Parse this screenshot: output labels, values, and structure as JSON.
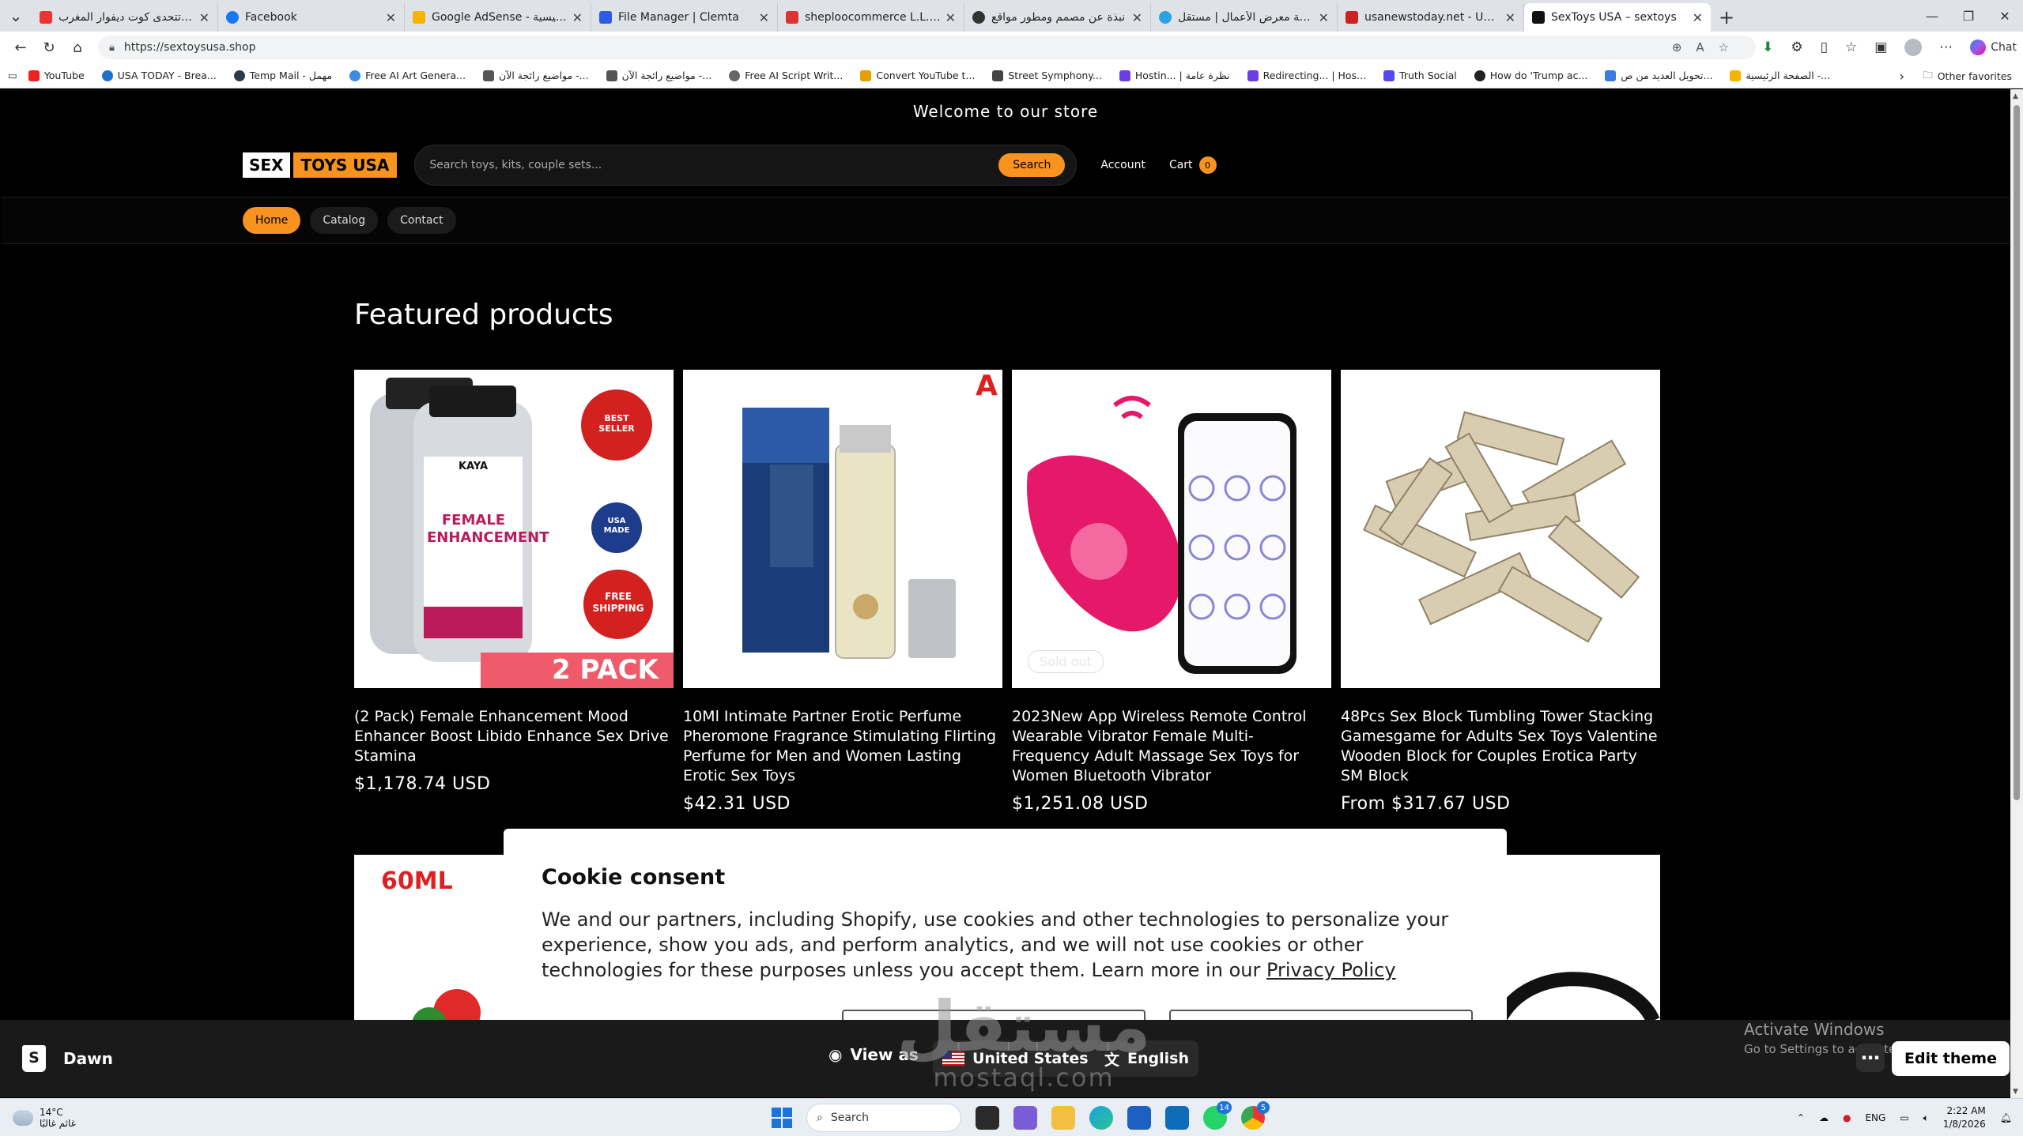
{
  "browser": {
    "tabs": [
      {
        "title": "مصر تتحدى كوت ديفوار المغرب...",
        "color": "#e33"
      },
      {
        "title": "Facebook",
        "color": "#1877f2"
      },
      {
        "title": "Google AdSense - الصفحة الرئيسية",
        "color": "#f4b400"
      },
      {
        "title": "File Manager | Clemta",
        "color": "#2d5be3"
      },
      {
        "title": "sheploocommerce L.L.C.- EIN Letter...",
        "color": "#d33"
      },
      {
        "title": "نبذة عن مصمم ومطور مواقع",
        "color": "#333"
      },
      {
        "title": "إضافة معرض الأعمال | مستقل",
        "color": "#2aa3e3"
      },
      {
        "title": "usanewstoday.net - USANewsToday...",
        "color": "#c22"
      },
      {
        "title": "SexToys USA – sextoys",
        "color": "#111"
      }
    ],
    "url": "https://sextoysusa.shop",
    "chat_label": "Chat",
    "bookmarks": [
      {
        "label": "YouTube",
        "color": "#e22"
      },
      {
        "label": "USA TODAY - Brea...",
        "color": "#1a73c8"
      },
      {
        "label": "Temp Mail - مهمل",
        "color": "#2b3b4b"
      },
      {
        "label": "Free AI Art Genera...",
        "color": "#3a8de0"
      },
      {
        "label": "مواضيع رائجة الآن -...",
        "color": "#555"
      },
      {
        "label": "مواضيع رائجة الآن -...",
        "color": "#555"
      },
      {
        "label": "Free AI Script Writ...",
        "color": "#666"
      },
      {
        "label": "Convert YouTube t...",
        "color": "#e6a100"
      },
      {
        "label": "Street Symphony...",
        "color": "#444"
      },
      {
        "label": "Hostin... | نظرة عامة",
        "color": "#6a3de8"
      },
      {
        "label": "Redirecting... | Hos...",
        "color": "#6a3de8"
      },
      {
        "label": "Truth Social",
        "color": "#5448ee"
      },
      {
        "label": "How do 'Trump ac...",
        "color": "#222"
      },
      {
        "label": "تحويل العديد من ص...",
        "color": "#3b7de0"
      },
      {
        "label": "الصفحة الرئيسية -...",
        "color": "#f4b400"
      }
    ],
    "other_favorites": "Other favorites"
  },
  "store": {
    "announcement": "Welcome to our store",
    "logo_part1": "SEX",
    "logo_part2": "TOYS USA",
    "search_placeholder": "Search toys, kits, couple sets...",
    "search_button": "Search",
    "account_label": "Account",
    "cart_label": "Cart",
    "cart_count": "0",
    "nav": [
      "Home",
      "Catalog",
      "Contact"
    ],
    "section_title": "Featured products",
    "products": [
      {
        "name": "(2 Pack) Female Enhancement Mood Enhancer Boost Libido Enhance Sex Drive Stamina",
        "price": "$1,178.74 USD"
      },
      {
        "name": "10Ml Intimate Partner Erotic Perfume Pheromone Fragrance Stimulating Flirting Perfume for Men and Women Lasting Erotic Sex Toys",
        "price": "$42.31 USD"
      },
      {
        "name": "2023New App Wireless Remote Control Wearable Vibrator Female Multi-Frequency Adult Massage Sex Toys for Women Bluetooth Vibrator",
        "price": "$1,251.08 USD"
      },
      {
        "name": "48Pcs Sex Block Tumbling Tower Stacking Gamesgame for Adults Sex Toys Valentine Wooden Block for Couples Erotica Party SM Block",
        "price": "From $317.67 USD"
      }
    ],
    "product_image_text": {
      "p1_banner": "2 PACK",
      "p1_badge1": "BEST SELLER",
      "p1_badge2": "USA MADE",
      "p1_badge3": "FREE SHIPPING",
      "p1_label": "FEMALE ENHANCEMENT",
      "p1_brand": "KAYA",
      "p2_corner": "A",
      "p3_soldout": "Sold out"
    },
    "row2_label": "60ML"
  },
  "cookie": {
    "title": "Cookie consent",
    "body": "We and our partners, including Shopify, use cookies and other technologies to personalize your experience, show you ads, and perform analytics, and we will not use cookies or other technologies for these purposes unless you accept them. Learn more in our ",
    "link": "Privacy Policy"
  },
  "preview_bar": {
    "theme_name": "Dawn",
    "view_as": "View as",
    "country": "United States",
    "language": "English",
    "edit_theme": "Edit theme"
  },
  "windows": {
    "activate_title": "Activate Windows",
    "activate_sub": "Go to Settings to activate Windows.",
    "weather_temp": "14°C",
    "weather_desc": "غائم غالبًا",
    "search": "Search",
    "lang": "ENG",
    "time": "2:22 AM",
    "date": "1/8/2026",
    "whatsapp_badge": "14",
    "chrome_badge": "5"
  },
  "watermark": {
    "arabic": "مستقل",
    "latin": "mostaql.com"
  },
  "colors": {
    "accent": "#f7931e",
    "page_bg": "#000000"
  }
}
